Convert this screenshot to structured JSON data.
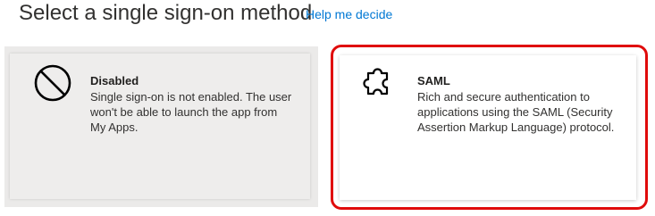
{
  "header": {
    "title": "Select a single sign-on method",
    "help_link": "Help me decide"
  },
  "options": [
    {
      "heading": "Disabled",
      "description": "Single sign-on is not enabled. The user won't be able to launch the app from My Apps.",
      "icon": "prohibited-icon",
      "state": "selected"
    },
    {
      "heading": "SAML",
      "description": "Rich and secure authentication to applications using the SAML (Security Assertion Markup Language) protocol.",
      "icon": "puzzle-piece-icon",
      "highlight_color": "#e00b0b"
    }
  ],
  "colors": {
    "link": "#0078d4",
    "selected_card_bg": "#eeedec",
    "highlight": "#e00b0b"
  }
}
